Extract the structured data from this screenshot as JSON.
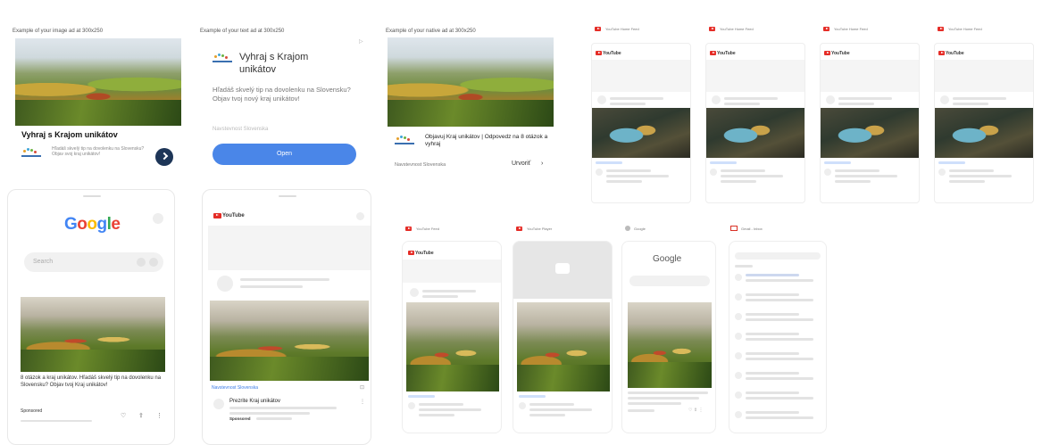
{
  "captions": {
    "image_ad": "Example of your image ad at 300x250",
    "text_ad": "Example of your text ad at 300x250",
    "native_ad": "Example of your native ad at 300x250"
  },
  "image_ad": {
    "headline": "Vyhraj s Krajom unikátov",
    "body": "Hľadáš skvelý tip na dovolenku na Slovensku? Objav svoj kraj unikátov!"
  },
  "text_ad": {
    "headline": "Vyhraj s Krajom unikátov",
    "body": "Hľadáš skvelý tip na dovolenku na Slovensku? Objav tvoj nový kraj unikátov!",
    "display_url": "Navstevnost Slovenska",
    "cta": "Open"
  },
  "native_ad": {
    "headline": "Objavuj Kraj unikátov | Odpovedz na 8 otázok a vyhraj",
    "advertiser": "Navstevnost Slovenska",
    "cta": "Urvoriť"
  },
  "youtube_previews": {
    "header": "YouTube Home Feed",
    "logo": "YouTube"
  },
  "google_phone": {
    "logo": {
      "G": "G",
      "o1": "o",
      "o2": "o",
      "g": "g",
      "l": "l",
      "e": "e"
    },
    "search_placeholder": "Search",
    "ad_text": "8 otázok a kraj unikátov. Hľadáš skvelý tip na dovolenku na Slovensku? Objav tvoj Kraj unikátov!",
    "sponsored": "Sponsored"
  },
  "youtube_phone": {
    "logo": "YouTube",
    "tag": "Navstevnost Slovenska",
    "title": "Prezrite Kraj unikátov",
    "sponsored": "Sponsored"
  },
  "small_phones": [
    {
      "header": "YouTube Feed"
    },
    {
      "header": "YouTube Player"
    },
    {
      "header": "Google"
    },
    {
      "header": "Gmail - Inbox"
    }
  ],
  "small_google": {
    "logo": "Google"
  },
  "colors": {
    "accent": "#4285f4",
    "youtube": "#e52d27",
    "button_dark": "#1d3557"
  }
}
